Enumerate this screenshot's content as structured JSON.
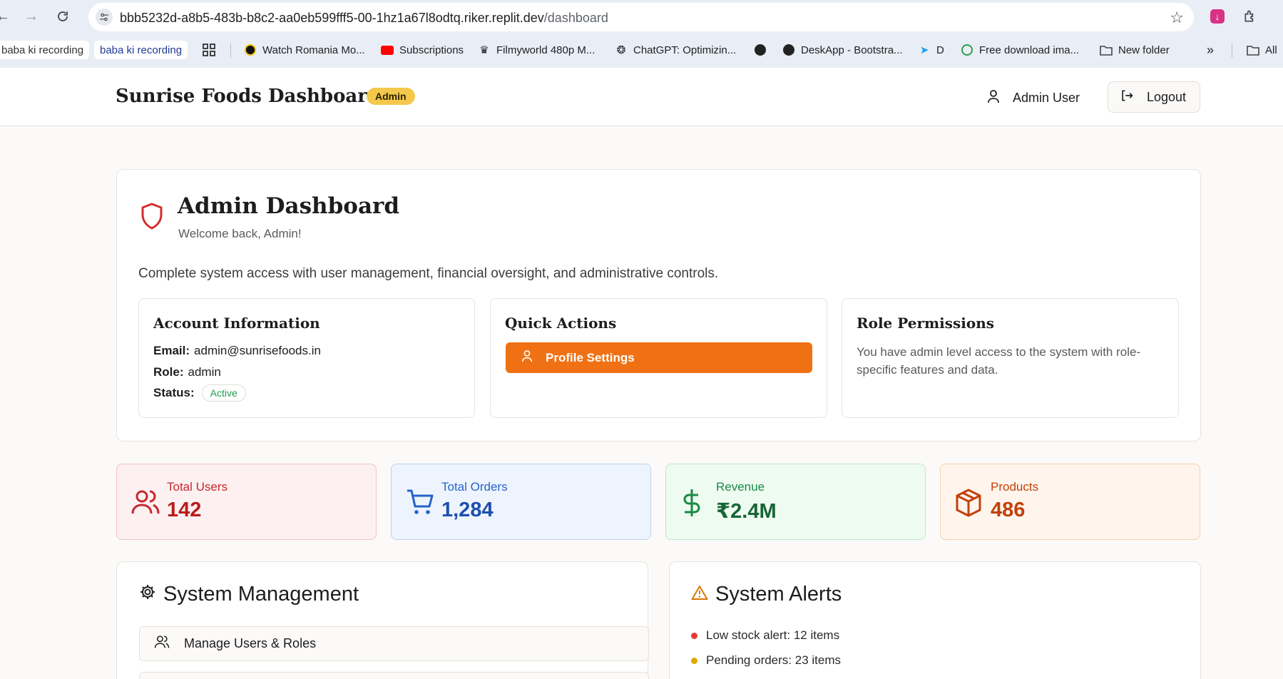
{
  "browser": {
    "url_host": "bbb5232d-a8b5-483b-b8c2-aa0eb599fff5-00-1hz1a67l8odtq.riker.replit.dev",
    "url_path": "/dashboard",
    "bookmarks": [
      {
        "label": "baba ki recording",
        "style": "chip-plain"
      },
      {
        "label": "baba ki recording",
        "style": "chip"
      },
      {
        "label": "Watch Romania Mo..."
      },
      {
        "label": "Subscriptions"
      },
      {
        "label": "Filmyworld 480p M..."
      },
      {
        "label": "ChatGPT: Optimizin..."
      },
      {
        "label": ""
      },
      {
        "label": "DeskApp - Bootstra..."
      },
      {
        "label": "D"
      },
      {
        "label": "Free download ima..."
      },
      {
        "label": "New folder"
      },
      {
        "label": "All"
      }
    ],
    "overflow": "»"
  },
  "header": {
    "brand": "Sunrise Foods Dashboard",
    "role_badge": "Admin",
    "user_name": "Admin User",
    "logout_label": "Logout"
  },
  "main": {
    "title": "Admin Dashboard",
    "welcome": "Welcome back, Admin!",
    "description": "Complete system access with user management, financial oversight, and administrative controls.",
    "account": {
      "title": "Account Information",
      "email_label": "Email:",
      "email": "admin@sunrisefoods.in",
      "role_label": "Role:",
      "role": "admin",
      "status_label": "Status:",
      "status": "Active"
    },
    "quick_actions": {
      "title": "Quick Actions",
      "profile_button": "Profile Settings"
    },
    "permissions": {
      "title": "Role Permissions",
      "text": "You have admin level access to the system with role-specific features and data."
    }
  },
  "stats": [
    {
      "label": "Total Users",
      "value": "142",
      "color": "#c5282f"
    },
    {
      "label": "Total Orders",
      "value": "1,284",
      "color": "#2563c9"
    },
    {
      "label": "Revenue",
      "value": "₹2.4M",
      "color": "#1b8a45"
    },
    {
      "label": "Products",
      "value": "486",
      "color": "#c2410c"
    }
  ],
  "system_management": {
    "title": "System Management",
    "items": [
      "Manage Users & Roles"
    ]
  },
  "system_alerts": {
    "title": "System Alerts",
    "items": [
      {
        "text": "Low stock alert: 12 items",
        "color": "#e53935"
      },
      {
        "text": "Pending orders: 23 items",
        "color": "#e0a800"
      }
    ]
  },
  "colors": {
    "accent": "#f07114",
    "badge": "#f3c84b"
  }
}
